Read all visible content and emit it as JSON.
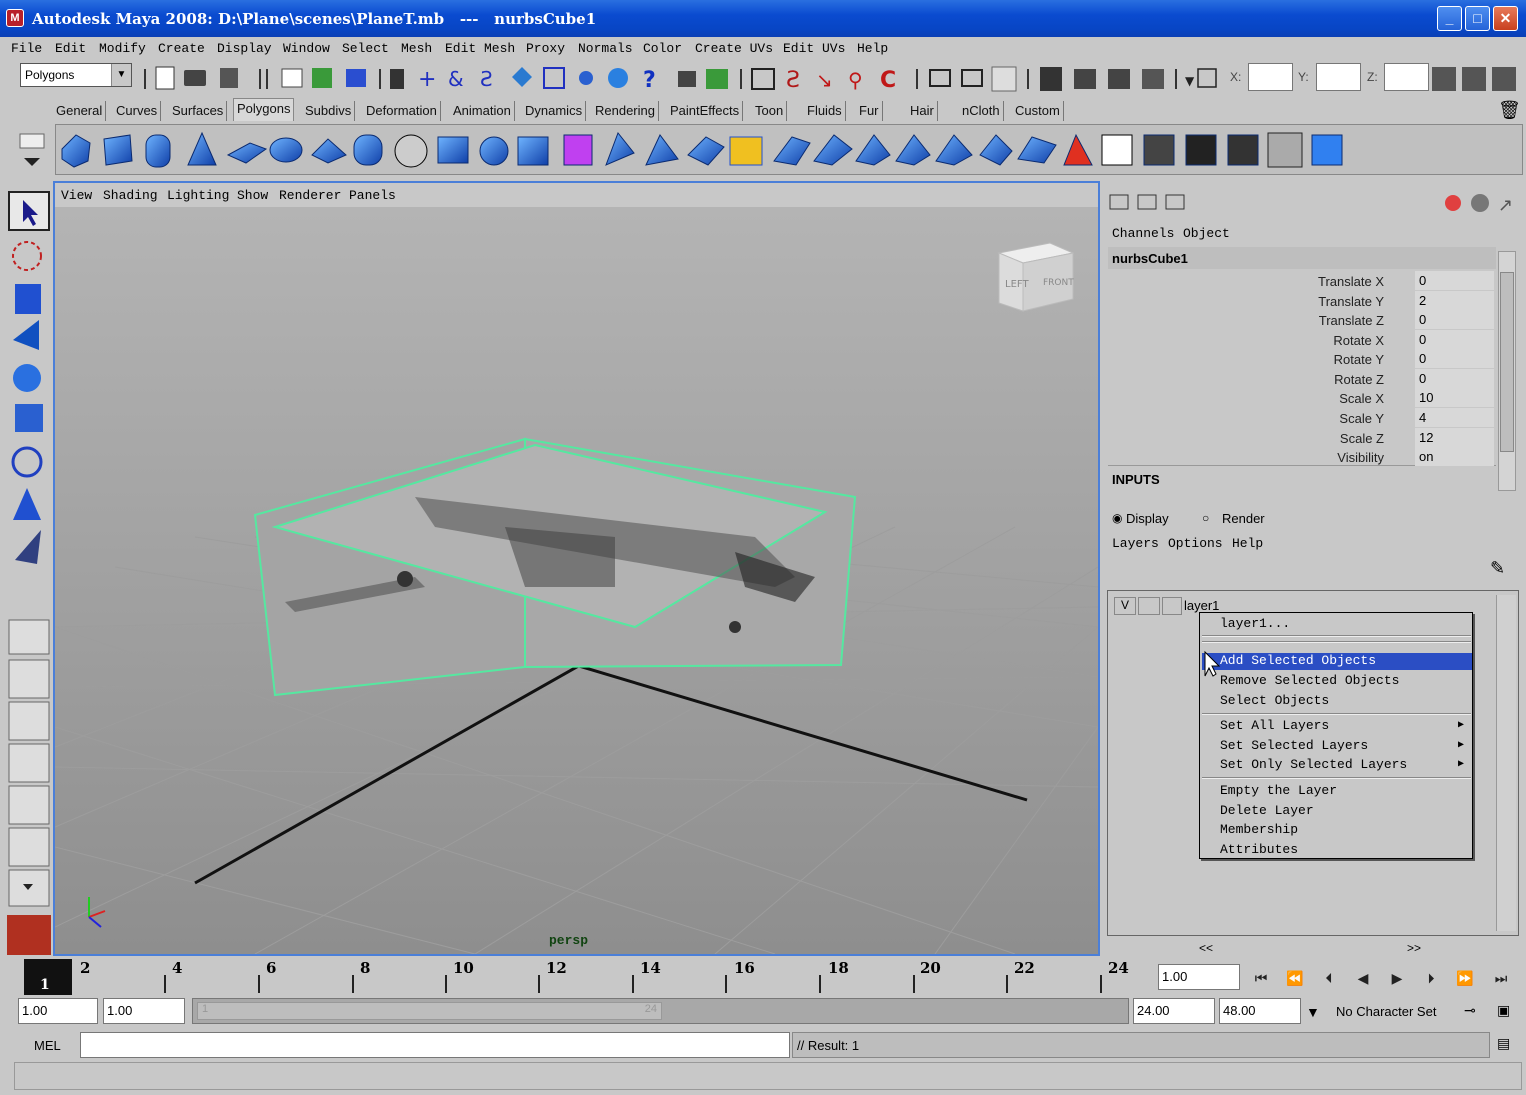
{
  "titlebar": {
    "title": "Autodesk Maya 2008: D:\\Plane\\scenes\\PlaneT.mb   ---   nurbsCube1",
    "icon": "maya-app-icon",
    "minimize": "_",
    "maximize": "□",
    "close": "✕"
  },
  "menubar": [
    "File",
    "Edit",
    "Modify",
    "Create",
    "Display",
    "Window",
    "Select",
    "Mesh",
    "Edit Mesh",
    "Proxy",
    "Normals",
    "Color",
    "Create UVs",
    "Edit UVs",
    "Help"
  ],
  "statusline": {
    "menuset": "Polygons",
    "x_label": "X:",
    "y_label": "Y:",
    "z_label": "Z:"
  },
  "shelf_tabs": [
    "General",
    "Curves",
    "Surfaces",
    "Polygons",
    "Subdivs",
    "Deformation",
    "Animation",
    "Dynamics",
    "Rendering",
    "PaintEffects",
    "Toon",
    "Fluids",
    "Fur",
    "Hair",
    "nCloth",
    "Custom"
  ],
  "active_shelf_tab": "Polygons",
  "viewport": {
    "menus": [
      "View",
      "Shading",
      "Lighting",
      "Show",
      "Renderer",
      "Panels"
    ],
    "camera_label": "persp",
    "viewcube_left": "LEFT",
    "viewcube_front": "FRONT"
  },
  "channelbox": {
    "tabs": [
      "Channels",
      "Object"
    ],
    "object_name": "nurbsCube1",
    "attributes": [
      {
        "label": "Translate X",
        "value": "0"
      },
      {
        "label": "Translate Y",
        "value": "2"
      },
      {
        "label": "Translate Z",
        "value": "0"
      },
      {
        "label": "Rotate X",
        "value": "0"
      },
      {
        "label": "Rotate Y",
        "value": "0"
      },
      {
        "label": "Rotate Z",
        "value": "0"
      },
      {
        "label": "Scale X",
        "value": "10"
      },
      {
        "label": "Scale Y",
        "value": "4"
      },
      {
        "label": "Scale Z",
        "value": "12"
      },
      {
        "label": "Visibility",
        "value": "on"
      }
    ],
    "inputs_label": "INPUTS"
  },
  "layers": {
    "display_radio": "Display",
    "render_radio": "Render",
    "menus": [
      "Layers",
      "Options",
      "Help"
    ],
    "layer_visible": "V",
    "layer_name": "layer1",
    "nav_left": "<<",
    "nav_right": ">>"
  },
  "context_menu": {
    "header": "layer1...",
    "items": [
      {
        "label": "Add Selected Objects"
      },
      {
        "label": "Remove Selected Objects"
      },
      {
        "label": "Select Objects"
      },
      {
        "label": "Set All Layers"
      },
      {
        "label": "Set Selected Layers"
      },
      {
        "label": "Set Only Selected Layers"
      },
      {
        "label": "Empty the Layer"
      },
      {
        "label": "Delete Layer"
      },
      {
        "label": "Membership"
      },
      {
        "label": "Attributes"
      }
    ]
  },
  "timeslider": {
    "ticks": [
      "1",
      "2",
      "4",
      "6",
      "8",
      "10",
      "12",
      "14",
      "16",
      "18",
      "20",
      "22",
      "24"
    ],
    "current_frame_field": "1.00"
  },
  "rangeslider": {
    "start": "1.00",
    "inner_start": "1.00",
    "range_marker_start": "1",
    "range_marker_end": "24",
    "inner_end": "24.00",
    "end": "48.00",
    "character_set": "No Character Set"
  },
  "commandline": {
    "label": "MEL",
    "result": "// Result: 1"
  },
  "colors": {
    "titlebar": "#0a4bd0",
    "highlight": "#2b4ec4",
    "viewport_border": "#4b7fd8",
    "selection_green": "#55e8a0"
  }
}
